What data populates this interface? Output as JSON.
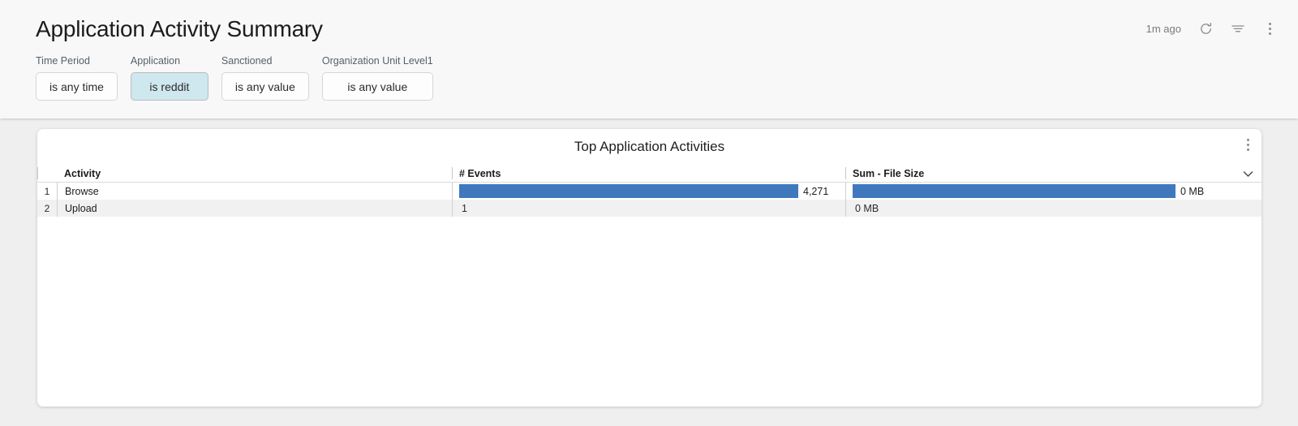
{
  "header": {
    "title": "Application Activity Summary",
    "last_refresh": "1m ago",
    "refresh_icon": "refresh-icon",
    "filter_icon": "filter-icon",
    "more_icon": "dots-vertical-icon"
  },
  "filters": [
    {
      "label": "Time Period",
      "value": "is any time",
      "active": false
    },
    {
      "label": "Application",
      "value": "is reddit",
      "active": true
    },
    {
      "label": "Sanctioned",
      "value": "is any value",
      "active": false
    },
    {
      "label": "Organization Unit Level1",
      "value": "is any value",
      "active": false
    }
  ],
  "card": {
    "title": "Top Application Activities",
    "menu_icon": "dots-vertical-icon",
    "sort_icon": "chevron-down-icon"
  },
  "chart_data": {
    "type": "table",
    "title": "Top Application Activities",
    "columns": [
      "Activity",
      "# Events",
      "Sum - File Size"
    ],
    "row_numbers": [
      "1",
      "2"
    ],
    "rows": [
      {
        "number": "1",
        "activity": "Browse",
        "events_label": "4,271",
        "events_value": 4271,
        "events_bar_pct": 100,
        "file_size_label": "0 MB",
        "file_size_value": 0,
        "file_size_bar_pct": 100
      },
      {
        "number": "2",
        "activity": "Upload",
        "events_label": "1",
        "events_value": 1,
        "events_bar_pct": 0,
        "file_size_label": "0 MB",
        "file_size_value": 0,
        "file_size_bar_pct": 0
      }
    ],
    "bar_color": "#4078be",
    "sorted_by": "Sum - File Size",
    "sort_direction": "descending"
  },
  "colors": {
    "bar": "#4078be",
    "active_chip": "#cfe7ee",
    "page_bg": "#efefef",
    "header_bg": "#f8f8f8"
  }
}
